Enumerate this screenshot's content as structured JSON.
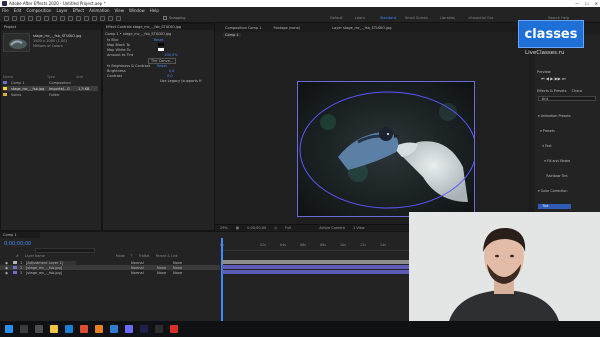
{
  "window": {
    "title": "Adobe After Effects 2020 - Untitled Project.aep *",
    "controls": [
      "—",
      "☐",
      "✕"
    ]
  },
  "menu": [
    "File",
    "Edit",
    "Composition",
    "Layer",
    "Effect",
    "Animation",
    "View",
    "Window",
    "Help"
  ],
  "toolbar": {
    "snapping_label": "Snapping",
    "workspaces": [
      "Default",
      "Learn",
      "Standard",
      "Small Screen",
      "Libraries",
      "»Essential Gra"
    ],
    "active_workspace": "Standard",
    "search_placeholder": "Search Help"
  },
  "project_panel": {
    "tab": "Project",
    "selected_file": "stage_mc_-_fsb_STUDIO.jpg",
    "selected_info": "1920 x 1080 (1,00)",
    "selected_info2": "Millions of Colors",
    "columns": [
      "Name",
      "Type",
      "Size"
    ],
    "items": [
      {
        "name": "Comp 1",
        "type": "Composition",
        "size": "",
        "color": "#6f6fc9"
      },
      {
        "name": "stage_mc_-_fsb.jpg",
        "type": "ImporteJ...G",
        "size": "1,3 KB",
        "color": "#ffcf3a"
      },
      {
        "name": "Solids",
        "type": "Folder",
        "size": "",
        "color": "#d9b038"
      }
    ]
  },
  "effect_controls": {
    "tab": "Effect Controls stage_mc_-_fsb_STUDIO.jpg",
    "header": "Comp 1 • stage_mc_-_fsb_STUDIO.jpg",
    "rows": [
      {
        "label": "fx  Blur",
        "value": "Reset"
      },
      {
        "label": "Map Black To",
        "value": ""
      },
      {
        "label": "Map White To",
        "value": ""
      },
      {
        "label": "Amount to Tint",
        "value": "100,0%"
      },
      {
        "label": "",
        "value": "Tint Conve..."
      },
      {
        "label": "fx  Brightness & Contrast",
        "value": "Reset"
      },
      {
        "label": "Brightness",
        "value": "0,0"
      },
      {
        "label": "Contrast",
        "value": "0,0"
      },
      {
        "label": "",
        "value": "Use Legacy (supports H"
      }
    ]
  },
  "viewer": {
    "tab": "Composition Comp 1",
    "tab2": "Footage (none)",
    "tab3": "Layer stage_mc_-_fsb_STUDIO.jpg",
    "breadcrumb": "Comp 1",
    "zoom": "29%",
    "timecode": "0;00;00;00",
    "resolution": "Full",
    "camera": "Active Camera",
    "views": "1 View"
  },
  "right_panel": {
    "info_tab": "Info",
    "audio_tab": "Audio",
    "preview_tab": "Preview",
    "effects_tab": "Effects & Presets",
    "char_tab": "Chara",
    "search_value": "tint",
    "tree": [
      "▾ Animation Presets",
      "  ▾ Presets",
      "    ▾ Text",
      "      ▾ Fill and Stroke",
      "        Rainbow Tint",
      "▾ Color Correction",
      "    Tint"
    ]
  },
  "brand": {
    "logo_text": "classes",
    "site": "LiveClasses.ru"
  },
  "timeline": {
    "tab": "Comp 1",
    "timecode": "0;00;00;00",
    "columns": [
      "#",
      "Layer Name",
      "Mode",
      "T",
      "TrkMat",
      "Parent & Link"
    ],
    "layers": [
      {
        "num": "1",
        "name": "[Adjustment Layer 1]",
        "mode": "Normal",
        "trkmat": "",
        "parent": "None",
        "color": "#b3b3b3"
      },
      {
        "num": "2",
        "name": "[stage_mc_-_fsb.jpg]",
        "mode": "Normal",
        "trkmat": "None",
        "parent": "None",
        "color": "#6f6fc9"
      },
      {
        "num": "3",
        "name": "[stage_mc_-_fsb.jpg]",
        "mode": "Normal",
        "trkmat": "None",
        "parent": "None",
        "color": "#6f6fc9"
      }
    ],
    "ruler": [
      "0s",
      "02s",
      "04s",
      "06s",
      "08s",
      "10s",
      "12s",
      "14s",
      "16s",
      "18s",
      "20s",
      "22s",
      "24s",
      "26s",
      "28s"
    ]
  },
  "taskbar": {
    "icons": [
      "windows-logo",
      "search",
      "task-view",
      "file-explorer",
      "edge",
      "chrome",
      "firefox",
      "store",
      "after-effects",
      "premiere",
      "settings",
      "acrobat"
    ]
  }
}
